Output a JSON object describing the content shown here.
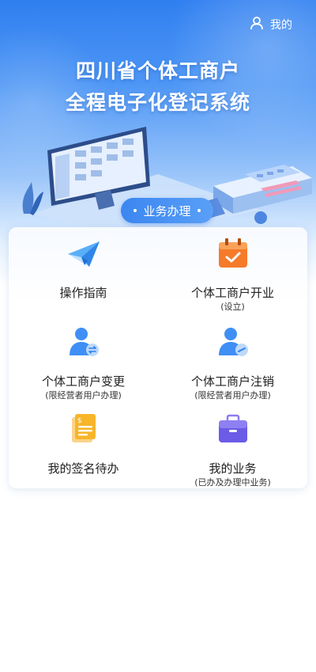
{
  "header": {
    "mine_label": "我的",
    "title_line1": "四川省个体工商户",
    "title_line2": "全程电子化登记系统"
  },
  "section": {
    "label": "业务办理"
  },
  "menu": [
    {
      "label": "操作指南",
      "sub": "",
      "icon": "paper-plane-icon"
    },
    {
      "label": "个体工商户开业",
      "sub": "(设立)",
      "icon": "calendar-check-icon"
    },
    {
      "label": "个体工商户变更",
      "sub": "(限经营者用户办理)",
      "icon": "user-change-icon"
    },
    {
      "label": "个体工商户注销",
      "sub": "(限经营者用户办理)",
      "icon": "user-cancel-icon"
    },
    {
      "label": "我的签名待办",
      "sub": "",
      "icon": "signature-doc-icon"
    },
    {
      "label": "我的业务",
      "sub": "(已办及办理中业务)",
      "icon": "briefcase-icon"
    }
  ],
  "colors": {
    "primary": "#2f7ff0",
    "icon_blue": "#3f8ff5",
    "icon_orange": "#f57a2a",
    "icon_yellow": "#f7b52a",
    "icon_purple": "#6b5be6"
  }
}
